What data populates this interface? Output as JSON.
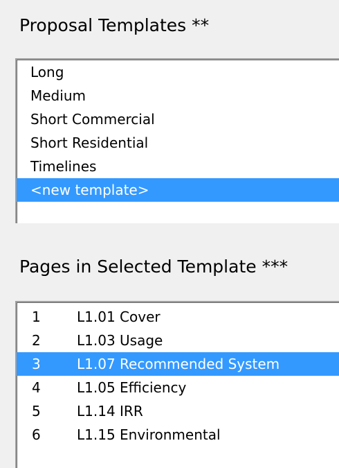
{
  "proposal_templates": {
    "heading": "Proposal Templates **",
    "items": [
      {
        "label": "Long"
      },
      {
        "label": "Medium"
      },
      {
        "label": "Short Commercial"
      },
      {
        "label": "Short Residential"
      },
      {
        "label": "Timelines"
      },
      {
        "label": "<new template>"
      }
    ],
    "selected_index": 5
  },
  "pages_in_selected_template": {
    "heading": "Pages in Selected Template ***",
    "items": [
      {
        "num": "1",
        "name": "L1.01 Cover"
      },
      {
        "num": "2",
        "name": "L1.03 Usage"
      },
      {
        "num": "3",
        "name": "L1.07 Recommended System"
      },
      {
        "num": "4",
        "name": "L1.05 Efficiency"
      },
      {
        "num": "5",
        "name": "L1.14 IRR"
      },
      {
        "num": "6",
        "name": "L1.15 Environmental"
      }
    ],
    "selected_index": 2
  },
  "colors": {
    "selection_background": "#3399ff",
    "selection_text": "#ffffff",
    "window_background": "#f0f0f0",
    "list_background": "#ffffff"
  }
}
